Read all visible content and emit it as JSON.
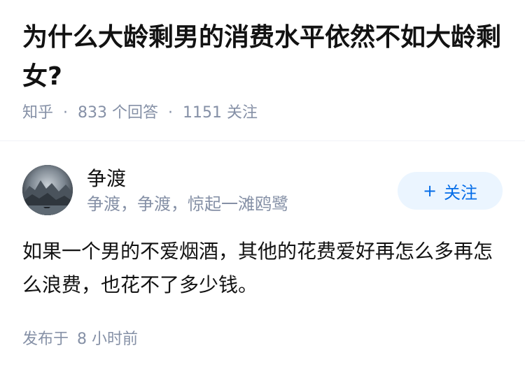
{
  "question": {
    "title": "为什么大龄剩男的消费水平依然不如大龄剩女?",
    "source": "知乎",
    "separator": "·",
    "answers_count": "833 个回答",
    "followers_count": "1151 关注"
  },
  "answer": {
    "author": {
      "name": "争渡",
      "headline": "争渡，争渡，惊起一滩鸥鹭",
      "avatar_icon": "landscape-avatar"
    },
    "follow_button": {
      "icon": "+",
      "label": "关注"
    },
    "content": "如果一个男的不爱烟酒，其他的花费爱好再怎么多再怎么浪费，也花不了多少钱。",
    "time_prefix": "发布于",
    "time": "8 小时前"
  },
  "colors": {
    "title": "#121212",
    "meta": "#8590a6",
    "accent": "#056de8",
    "follow_bg": "#ebf5ff"
  }
}
